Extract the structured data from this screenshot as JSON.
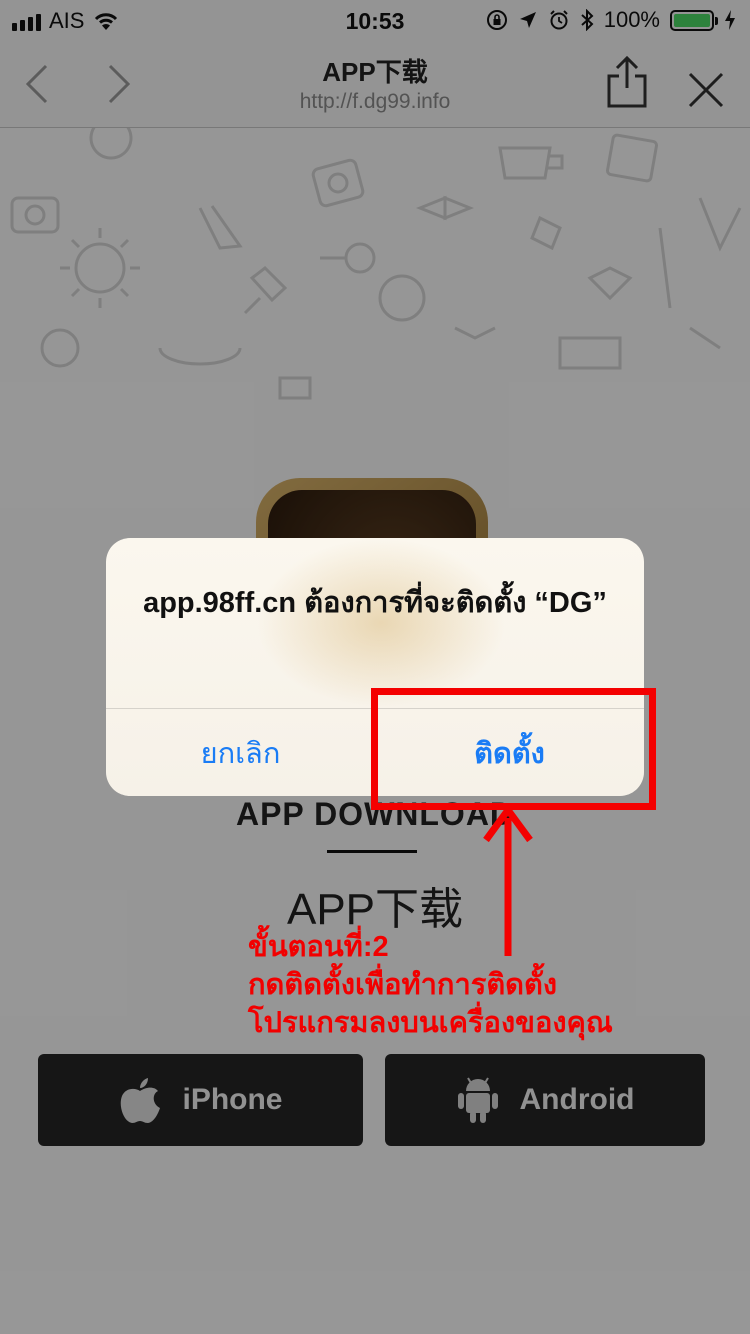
{
  "status_bar": {
    "carrier": "AIS",
    "time": "10:53",
    "battery_percent": "100%",
    "battery_level": 1.0,
    "icons": [
      "signal-icon",
      "wifi-icon",
      "orientation-lock-icon",
      "location-icon",
      "alarm-icon",
      "bluetooth-icon",
      "battery-icon",
      "charging-icon"
    ]
  },
  "nav_bar": {
    "title": "APP下载",
    "url": "http://f.dg99.info",
    "icons": [
      "back-icon",
      "forward-icon",
      "share-icon",
      "close-icon"
    ]
  },
  "page": {
    "app_icon_icon": "dg-app-icon",
    "heading": "APP DOWNLOAD",
    "subheading": "APP下载",
    "buttons": {
      "iphone_label": "iPhone",
      "android_label": "Android"
    }
  },
  "alert": {
    "title": "app.98ff.cn ต้องการที่จะติดตั้ง “DG”",
    "cancel_label": "ยกเลิก",
    "install_label": "ติดตั้ง"
  },
  "annotation": {
    "lines": [
      "ขั้นตอนที่:2",
      "กดติดตั้งเพื่อทำการติดตั้ง",
      "โปรแกรมลงบนเครื่องของคุณ"
    ],
    "color": "#f40000"
  },
  "colors": {
    "ios_blue": "#1a7cf5",
    "battery_green": "#4cd964",
    "button_dark": "#262626"
  }
}
